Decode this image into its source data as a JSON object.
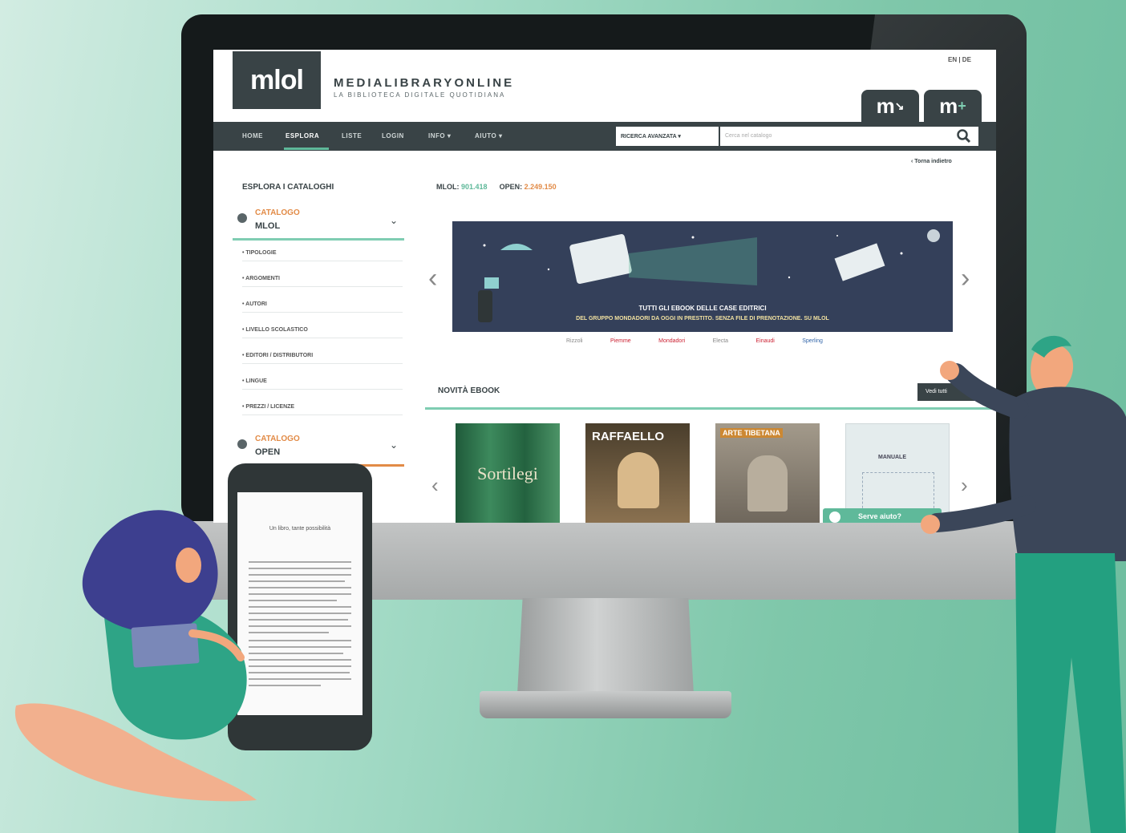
{
  "colors": {
    "dark": "#394346",
    "accent": "#5fb99a",
    "orange": "#e28b47",
    "banner": "#34405a"
  },
  "header": {
    "logo_text": "mlol",
    "title": "MEDIALIBRARYONLINE",
    "subtitle": "LA BIBLIOTECA DIGITALE QUOTIDIANA",
    "lang": "EN | DE",
    "button_1": "m",
    "button_2": "m"
  },
  "nav": {
    "items": [
      "HOME",
      "ESPLORA",
      "LISTE",
      "LOGIN",
      "INFO",
      "AIUTO"
    ],
    "search_select": "RICERCA AVANZATA",
    "search_placeholder": "Cerca nel catalogo",
    "back": "Torna indietro"
  },
  "sidebar": {
    "title": "ESPLORA I CATALOGHI",
    "catalog_1": {
      "label": "CATALOGO",
      "value": "MLOL"
    },
    "items": [
      "TIPOLOGIE",
      "ARGOMENTI",
      "AUTORI",
      "LIVELLO SCOLASTICO",
      "EDITORI / DISTRIBUTORI",
      "LINGUE",
      "PREZZI / LICENZE"
    ],
    "catalog_2": {
      "label": "CATALOGO",
      "value": "OPEN"
    }
  },
  "main": {
    "counts": {
      "mlol_label": "MLOL:",
      "mlol_value": "901.418",
      "open_label": "OPEN:",
      "open_value": "2.249.150"
    },
    "banner_line_1": "TUTTI GLI EBOOK DELLE CASE EDITRICI",
    "banner_line_2": "DEL GRUPPO MONDADORI DA OGGI IN PRESTITO. SENZA FILE DI PRENOTAZIONE. SU MLOL",
    "banner_logos": [
      "Rizzoli",
      "Piemme",
      "Mondadori",
      "Electa",
      "Einaudi",
      "Sperling"
    ],
    "novita_title": "NOVITÀ EBOOK",
    "tutti_button": "Vedi tutti",
    "covers": [
      {
        "title": "Sortilegi",
        "color": "#2e6b47"
      },
      {
        "title": "RAFFAELLO",
        "color": "#6e5a3a"
      },
      {
        "title": "ARTE TIBETANA",
        "color": "#8b8378"
      },
      {
        "title": "MANUALE",
        "color": "#dfe8e9"
      }
    ],
    "help_chip": "Serve aiuto?"
  },
  "phone": {
    "title": "Un libro, tante possibilità"
  }
}
